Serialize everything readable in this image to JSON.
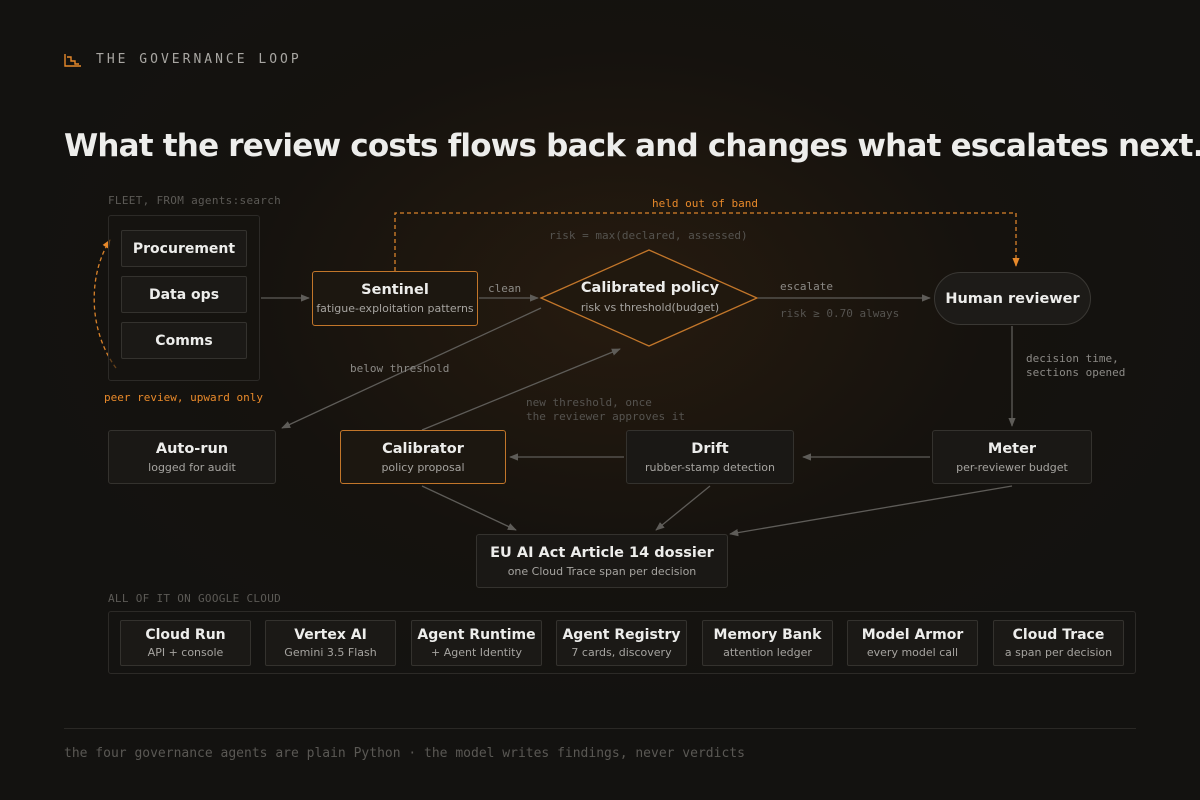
{
  "eyebrow": {
    "icon": "step-chart-icon",
    "text": "THE GOVERNANCE LOOP"
  },
  "headline": "What the review costs flows back and changes what escalates next.",
  "fleet": {
    "label": "FLEET, FROM agents:search",
    "items": [
      "Procurement",
      "Data ops",
      "Comms"
    ],
    "peer_review": "peer review, upward only"
  },
  "nodes": {
    "sentinel": {
      "title": "Sentinel",
      "subtitle": "fatigue-exploitation patterns"
    },
    "policy": {
      "title": "Calibrated policy",
      "subtitle": "risk vs threshold(budget)"
    },
    "human": {
      "title": "Human reviewer"
    },
    "autorun": {
      "title": "Auto-run",
      "subtitle": "logged for audit"
    },
    "calibrator": {
      "title": "Calibrator",
      "subtitle": "policy proposal"
    },
    "drift": {
      "title": "Drift",
      "subtitle": "rubber-stamp detection"
    },
    "meter": {
      "title": "Meter",
      "subtitle": "per-reviewer budget"
    },
    "dossier": {
      "title": "EU AI Act Article 14 dossier",
      "subtitle": "one Cloud Trace span per decision"
    }
  },
  "edges": {
    "held_out": "held out of band",
    "risk_formula": "risk = max(declared, assessed)",
    "clean": "clean",
    "escalate": "escalate",
    "risk_always": "risk ≥ 0.70 always",
    "below_threshold": "below threshold",
    "new_threshold_1": "new threshold, once",
    "new_threshold_2": "the reviewer approves it",
    "decision_1": "decision time,",
    "decision_2": "sections opened"
  },
  "cloud": {
    "label": "ALL OF IT ON GOOGLE CLOUD",
    "services": [
      {
        "name": "Cloud Run",
        "sub": "API + console"
      },
      {
        "name": "Vertex AI",
        "sub": "Gemini 3.5 Flash"
      },
      {
        "name": "Agent Runtime",
        "sub": "+ Agent Identity"
      },
      {
        "name": "Agent Registry",
        "sub": "7 cards, discovery"
      },
      {
        "name": "Memory Bank",
        "sub": "attention ledger"
      },
      {
        "name": "Model Armor",
        "sub": "every model call"
      },
      {
        "name": "Cloud Trace",
        "sub": "a span per decision"
      }
    ]
  },
  "footer": "the four governance agents are plain Python · the model writes findings, never verdicts",
  "colors": {
    "accent": "#e8892a",
    "node_border_highlight": "#c2762a",
    "background": "#131210"
  }
}
